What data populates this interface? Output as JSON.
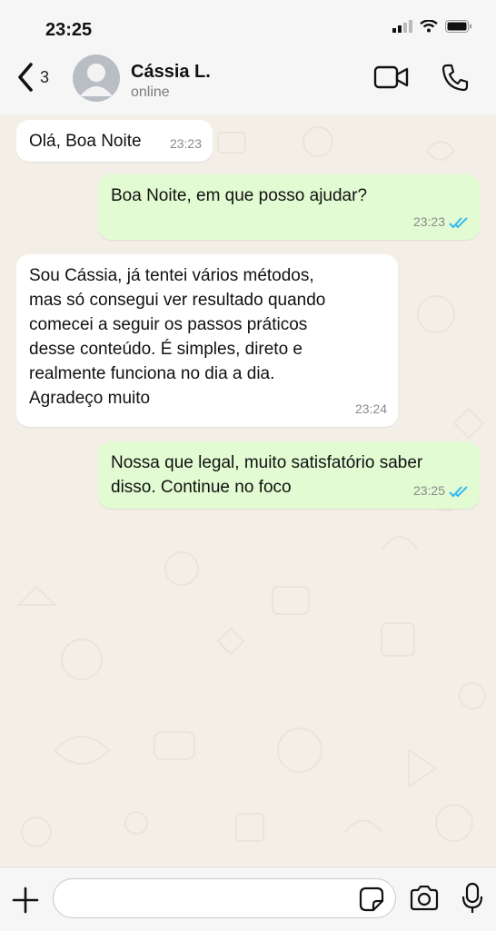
{
  "status_bar": {
    "time": "23:25"
  },
  "header": {
    "back_count": "3",
    "contact_name": "Cássia L.",
    "contact_status": "online"
  },
  "messages": [
    {
      "direction": "incoming",
      "text": "Olá, Boa Noite",
      "time": "23:23"
    },
    {
      "direction": "outgoing",
      "text": "Boa Noite, em que posso ajudar?",
      "time": "23:23",
      "read": true
    },
    {
      "direction": "incoming",
      "text": "Sou Cássia, já tentei vários métodos,\nmas só consegui ver resultado quando\ncomecei a seguir os passos práticos\ndesse conteúdo. É simples, direto e\nrealmente funciona no dia a dia.\nAgradeço muito",
      "time": "23:24"
    },
    {
      "direction": "outgoing",
      "text": "Nossa que legal, muito satisfatório saber\ndisso. Continue no foco",
      "time": "23:25",
      "read": true
    }
  ],
  "composer": {
    "placeholder": ""
  },
  "colors": {
    "incoming_bubble": "#ffffff",
    "outgoing_bubble": "#e2fbd2",
    "read_ticks": "#34b7f1",
    "wallpaper": "#f3efe7"
  },
  "icons": [
    "chevron-left-icon",
    "video-camera-icon",
    "phone-icon",
    "plus-icon",
    "sticker-icon",
    "camera-icon",
    "microphone-icon",
    "double-check-icon"
  ]
}
